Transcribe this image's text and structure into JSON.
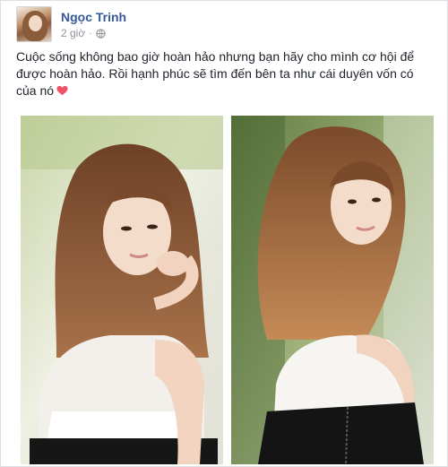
{
  "post": {
    "author": "Ngọc Trinh",
    "time": "2 giờ",
    "separator": "·",
    "text": "Cuộc sống không bao giờ hoàn hảo nhưng bạn hãy cho mình cơ hội để được hoàn hảo. Rồi hạnh phúc sẽ tìm đến bên ta như cái duyên vốn có của nó",
    "privacy_icon": "globe-icon",
    "emoji_icon": "pink-heart-icon",
    "photos": [
      {
        "alt": "photo-1"
      },
      {
        "alt": "photo-2"
      }
    ]
  },
  "colors": {
    "author": "#365899",
    "meta": "#90949c",
    "text": "#1d2129",
    "heart": "#f25268"
  }
}
